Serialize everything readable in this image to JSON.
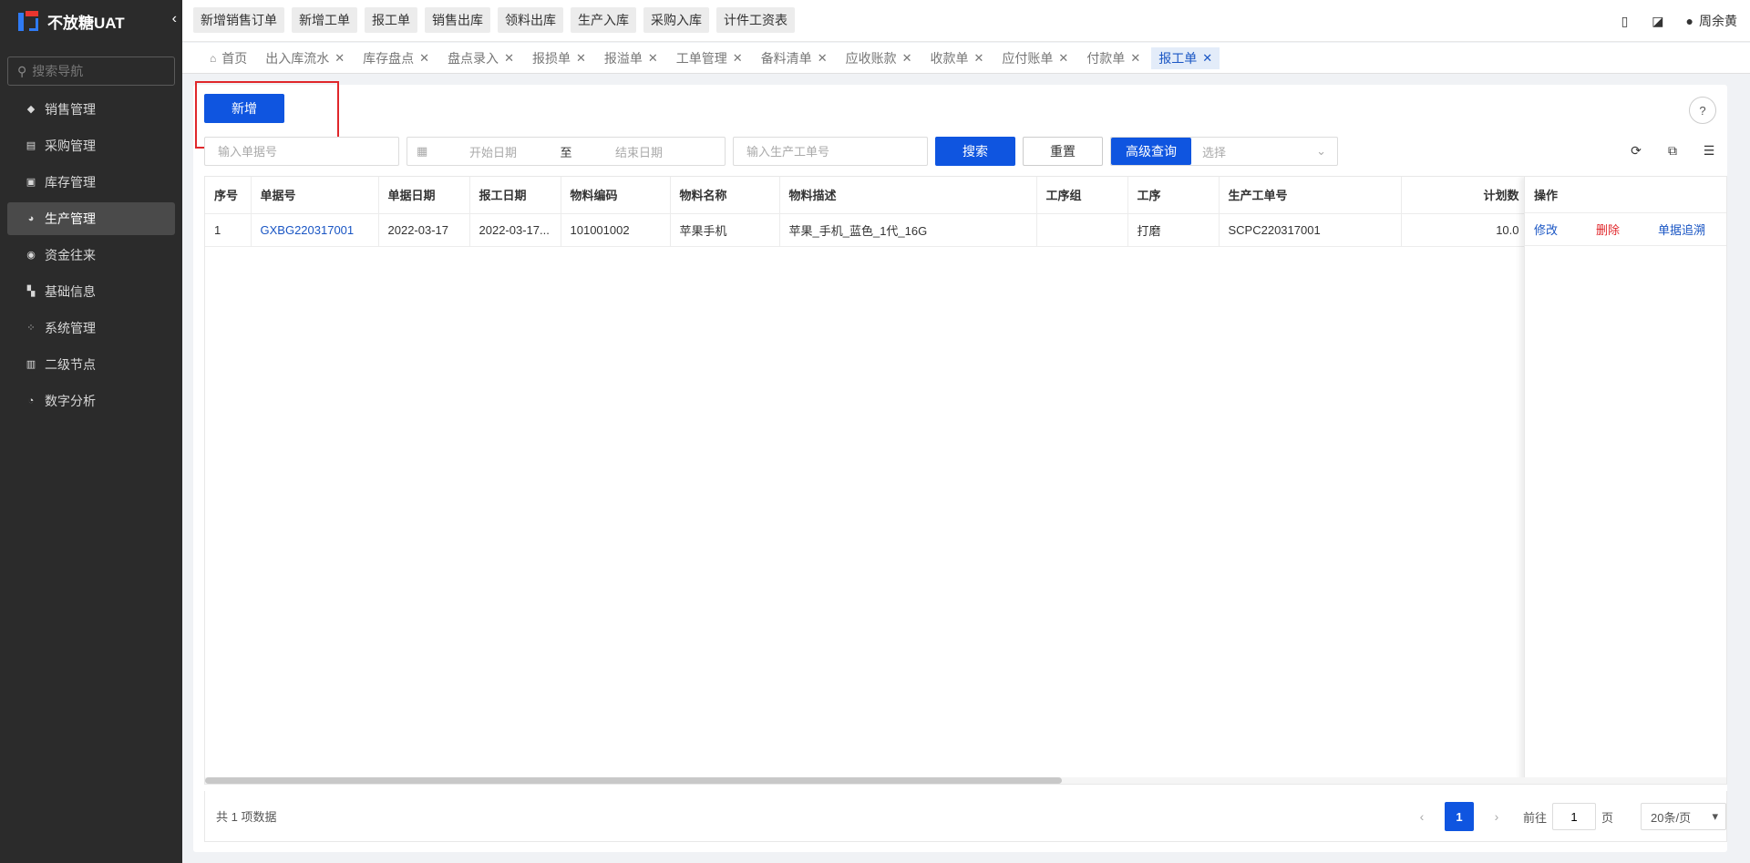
{
  "app": {
    "title": "不放糖UAT",
    "collapse_icon": "chevron-left-icon"
  },
  "sidebar": {
    "search_placeholder": "搜索导航",
    "items": [
      {
        "label": "销售管理",
        "icon": "tag-icon"
      },
      {
        "label": "采购管理",
        "icon": "cart-icon"
      },
      {
        "label": "库存管理",
        "icon": "warehouse-icon"
      },
      {
        "label": "生产管理",
        "icon": "factory-icon",
        "active": true
      },
      {
        "label": "资金往来",
        "icon": "money-icon"
      },
      {
        "label": "基础信息",
        "icon": "grid-icon"
      },
      {
        "label": "系统管理",
        "icon": "settings-icon"
      },
      {
        "label": "二级节点",
        "icon": "document-icon"
      },
      {
        "label": "数字分析",
        "icon": "pie-chart-icon"
      }
    ]
  },
  "topbar": {
    "quick_buttons": [
      "新增销售订单",
      "新增工单",
      "报工单",
      "销售出库",
      "领料出库",
      "生产入库",
      "采购入库",
      "计件工资表"
    ],
    "user_name": "周余黄"
  },
  "tabs": [
    {
      "label": "首页",
      "closable": false
    },
    {
      "label": "出入库流水",
      "closable": true
    },
    {
      "label": "库存盘点",
      "closable": true
    },
    {
      "label": "盘点录入",
      "closable": true
    },
    {
      "label": "报损单",
      "closable": true
    },
    {
      "label": "报溢单",
      "closable": true
    },
    {
      "label": "工单管理",
      "closable": true
    },
    {
      "label": "备料清单",
      "closable": true
    },
    {
      "label": "应收账款",
      "closable": true
    },
    {
      "label": "收款单",
      "closable": true
    },
    {
      "label": "应付账单",
      "closable": true
    },
    {
      "label": "付款单",
      "closable": true
    },
    {
      "label": "报工单",
      "closable": true,
      "active": true
    }
  ],
  "toolbar": {
    "new_label": "新增"
  },
  "filters": {
    "doc_no_placeholder": "输入单据号",
    "start_date_placeholder": "开始日期",
    "range_separator": "至",
    "end_date_placeholder": "结束日期",
    "work_order_placeholder": "输入生产工单号",
    "search_label": "搜索",
    "reset_label": "重置",
    "advanced_label": "高级查询",
    "select_placeholder": "选择"
  },
  "table": {
    "columns": [
      "序号",
      "单据号",
      "单据日期",
      "报工日期",
      "物料编码",
      "物料名称",
      "物料描述",
      "工序组",
      "工序",
      "生产工单号",
      "计划数"
    ],
    "ops_header": "操作",
    "rows": [
      {
        "cells": [
          "1",
          "GXBG220317001",
          "2022-03-17",
          "2022-03-17...",
          "101001002",
          "苹果手机",
          "苹果_手机_蓝色_1代_16G",
          "",
          "打磨",
          "SCPC220317001",
          "10.0"
        ],
        "ops": [
          "修改",
          "删除",
          "单据追溯"
        ]
      }
    ]
  },
  "footer": {
    "total_text": "共 1 项数据",
    "current_page": "1",
    "goto_prefix": "前往",
    "goto_value": "1",
    "goto_suffix": "页",
    "page_size": "20条/页"
  },
  "colors": {
    "primary": "#0f55e0",
    "danger": "#e0272b",
    "sidebar_bg": "#2b2b2b"
  }
}
